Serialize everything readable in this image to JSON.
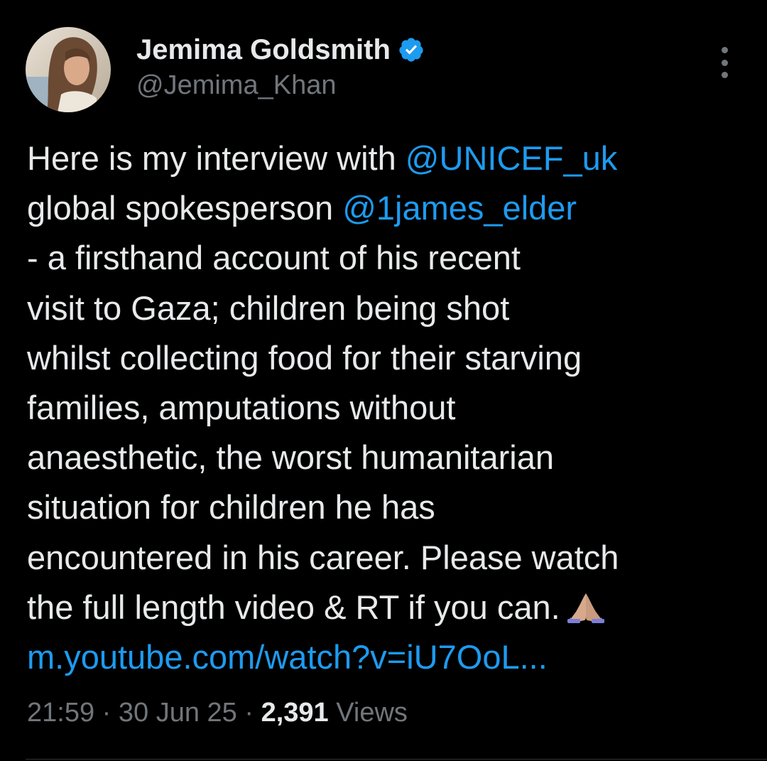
{
  "author": {
    "display_name": "Jemima Goldsmith",
    "handle": "@Jemima_Khan",
    "verified": true
  },
  "tweet": {
    "line1_text": "Here is my interview with ",
    "mention_unicef": "@UNICEF_uk",
    "line2_text": "global spokesperson ",
    "mention_elder": "@1james_elder",
    "line3": "- a firsthand account of his recent",
    "line4": "visit to Gaza; children being shot",
    "line5": "whilst collecting food for their starving",
    "line6": "families, amputations without",
    "line7": "anaesthetic, the worst humanitarian",
    "line8": "situation for children he has",
    "line9": "encountered in his career. Please watch",
    "line10": "the full length video & RT if you can.",
    "emoji": "folded-hands-emoji",
    "link": "m.youtube.com/watch?v=iU7OoL..."
  },
  "meta": {
    "time": "21:59",
    "separator": "·",
    "date": "30 Jun 25",
    "views_count": "2,391",
    "views_label": "Views"
  },
  "colors": {
    "background": "#000000",
    "text": "#e7e9ea",
    "secondary": "#71767b",
    "link": "#1d9bf0",
    "verified_badge": "#1d9bf0"
  },
  "icons": {
    "verified": "verified-badge-icon",
    "more": "more-options-icon"
  }
}
